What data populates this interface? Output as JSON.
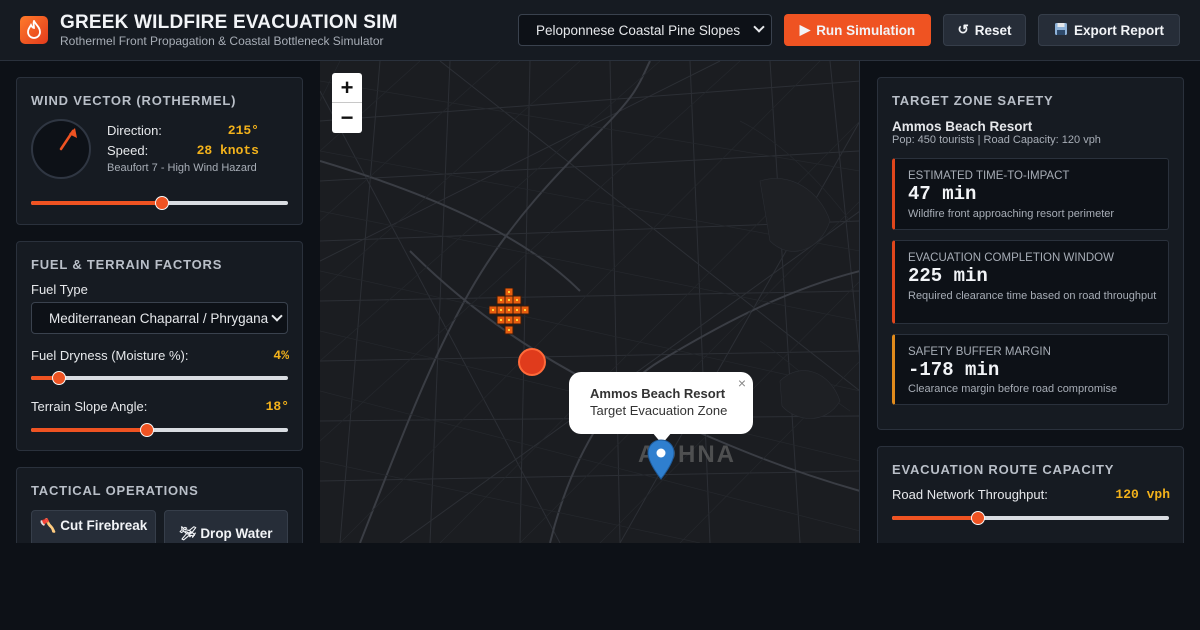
{
  "app": {
    "title": "GREEK WILDFIRE EVACUATION SIM",
    "subtitle": "Rothermel Front Propagation & Coastal Bottleneck Simulator",
    "scenario_selected": "Peloponnese Coastal Pine Slopes",
    "run_label": "Run Simulation",
    "reset_label": "Reset",
    "export_label": "Export Report",
    "colors": {
      "accent": "#ef5322",
      "highlight": "#f3b21b",
      "panel": "#161b22",
      "background": "#0d1117"
    }
  },
  "wind": {
    "title": "WIND VECTOR (ROTHERMEL)",
    "direction_label": "Direction:",
    "direction_value": "215°",
    "speed_label": "Speed:",
    "speed_value": "28 knots",
    "hazard_note": "Beaufort 7 - High Wind Hazard",
    "slider_fraction": 0.51
  },
  "fuel": {
    "title": "FUEL & TERRAIN FACTORS",
    "fuel_type_label": "Fuel Type",
    "fuel_type_value": "Mediterranean Chaparral / Phrygana",
    "dryness_label": "Fuel Dryness (Moisture %):",
    "dryness_value": "4%",
    "dryness_fraction": 0.11,
    "slope_label": "Terrain Slope Angle:",
    "slope_value": "18°",
    "slope_fraction": 0.45
  },
  "tactical": {
    "title": "TACTICAL OPERATIONS",
    "firebreak_label": "Cut Firebreak",
    "water_label": "Drop Water"
  },
  "map": {
    "zoom_in": "+",
    "zoom_out": "−",
    "popup_title": "Ammos Beach Resort",
    "popup_subtitle": "Target Evacuation Zone",
    "popup_close": "×",
    "place_label": "AΘHNA"
  },
  "target": {
    "title": "TARGET ZONE SAFETY",
    "zone_name": "Ammos Beach Resort",
    "zone_details": "Pop: 450 tourists | Road Capacity: 120 vph",
    "metrics": [
      {
        "label": "ESTIMATED TIME-TO-IMPACT",
        "value": "47 min",
        "desc": "Wildfire front approaching resort perimeter"
      },
      {
        "label": "EVACUATION COMPLETION WINDOW",
        "value": "225 min",
        "desc": "Required clearance time based on road throughput"
      },
      {
        "label": "SAFETY BUFFER MARGIN",
        "value": "-178 min",
        "desc": "Clearance margin before road compromise"
      }
    ]
  },
  "route": {
    "title": "EVACUATION ROUTE CAPACITY",
    "throughput_label": "Road Network Throughput:",
    "throughput_value": "120 vph",
    "throughput_fraction": 0.31
  }
}
